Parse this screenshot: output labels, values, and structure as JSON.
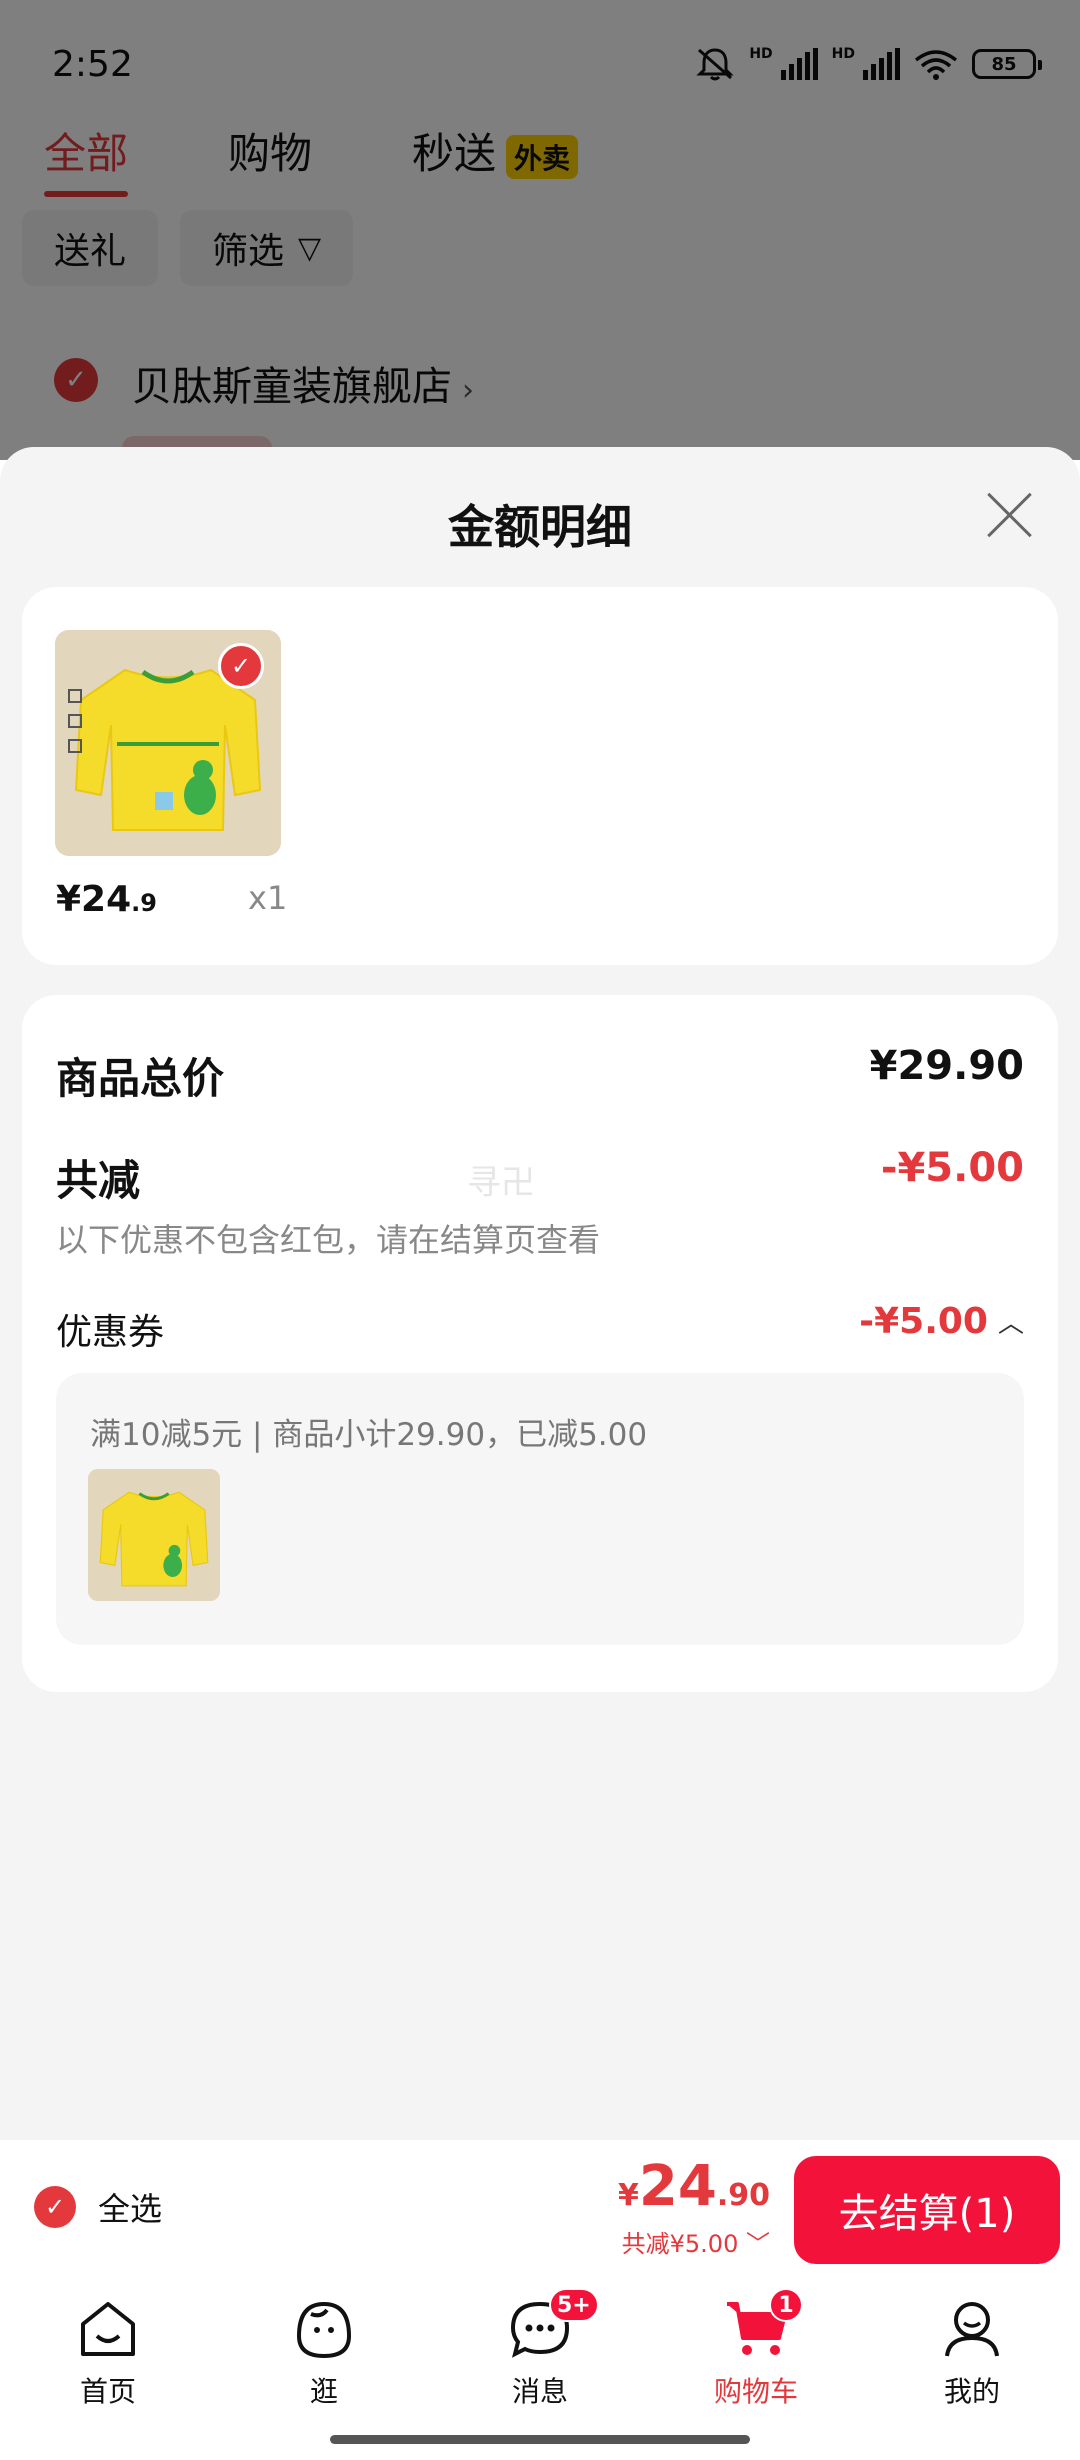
{
  "status_bar": {
    "time": "2:52",
    "battery": "85",
    "hd1": "HD",
    "hd2": "HD"
  },
  "top_tabs": [
    {
      "label": "全部"
    },
    {
      "label": "购物"
    },
    {
      "label": "秒送",
      "badge": "外卖"
    }
  ],
  "filter_chips": {
    "gift": "送礼",
    "filter": "筛选"
  },
  "store": {
    "name": "贝肽斯童装旗舰店"
  },
  "sheet": {
    "title": "金额明细",
    "item": {
      "price_int": "¥24",
      "price_dec": ".9",
      "qty": "x1"
    },
    "summary": {
      "total_label": "商品总价",
      "total_value": "¥29.90",
      "reduce_label": "共减",
      "reduce_value": "-¥5.00",
      "reduce_note": "以下优惠不包含红包，请在结算页查看",
      "watermark": "寻卍",
      "coupon_label": "优惠券",
      "coupon_value": "-¥5.00",
      "coupon_detail": "满10减5元 | 商品小计29.90，已减5.00"
    }
  },
  "checkout": {
    "select_all": "全选",
    "currency": "¥",
    "total_int": "24",
    "total_dec": ".90",
    "total_reduce": "共减¥5.00",
    "button": "去结算(1)"
  },
  "nav": [
    {
      "label": "首页",
      "icon": "home-icon"
    },
    {
      "label": "逛",
      "icon": "browse-face-icon"
    },
    {
      "label": "消息",
      "icon": "message-icon",
      "badge": "5+"
    },
    {
      "label": "购物车",
      "icon": "cart-icon",
      "badge": "1"
    },
    {
      "label": "我的",
      "icon": "profile-icon"
    }
  ],
  "colors": {
    "accent": "#e4393c",
    "button": "#f2123a",
    "product_yellow": "#f5dc2a"
  }
}
